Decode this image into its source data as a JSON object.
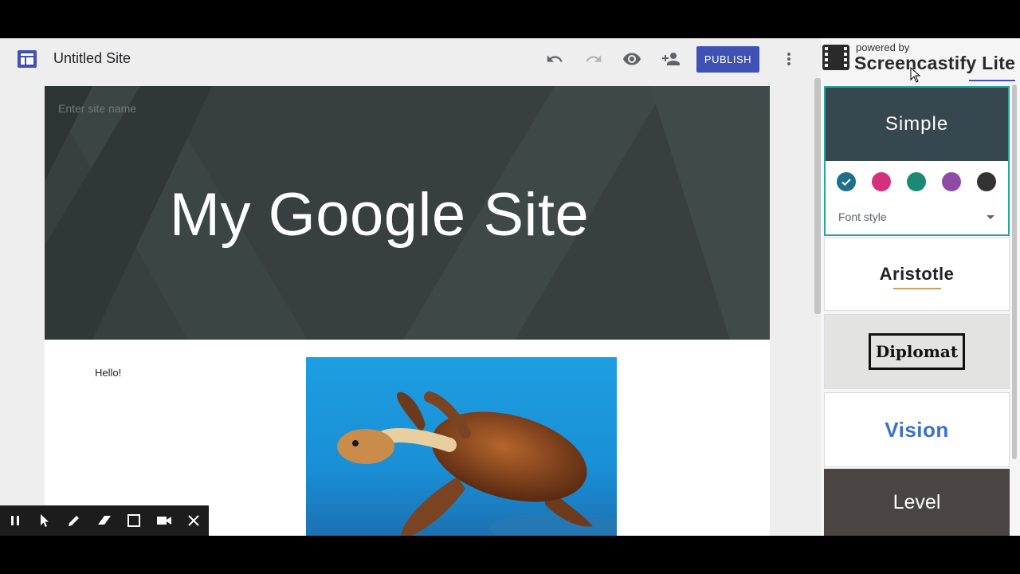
{
  "topbar": {
    "app_icon": "google-sites-icon",
    "site_title": "Untitled Site",
    "undo_icon": "undo-icon",
    "redo_icon": "redo-icon",
    "preview_icon": "eye-icon",
    "share_icon": "add-person-icon",
    "publish_label": "PUBLISH",
    "more_icon": "more-vert-icon"
  },
  "canvas": {
    "site_name_placeholder": "Enter site name",
    "hero_title": "My Google Site",
    "hello_text": "Hello!",
    "image_subject": "sea turtle photo"
  },
  "watermark": {
    "powered_by": "powered by",
    "name": "Screencastify Lite"
  },
  "themes": {
    "simple": {
      "name": "Simple",
      "swatches": [
        "#1f6f8b",
        "#d5307b",
        "#1a8a76",
        "#8e4aa6",
        "#333333"
      ],
      "selected_swatch": 0,
      "font_style_label": "Font style"
    },
    "aristotle": {
      "name": "Aristotle"
    },
    "diplomat": {
      "name": "Diplomat"
    },
    "vision": {
      "name": "Vision"
    },
    "level": {
      "name": "Level"
    }
  },
  "toolbar": {
    "tools": [
      "pause-icon",
      "pointer-icon",
      "pen-icon",
      "eraser-icon",
      "rectangle-icon",
      "camera-icon",
      "close-icon"
    ]
  },
  "colors": {
    "accent": "#3f51b5",
    "hero_bg": "#37403f",
    "selected_border": "#26a69a"
  }
}
